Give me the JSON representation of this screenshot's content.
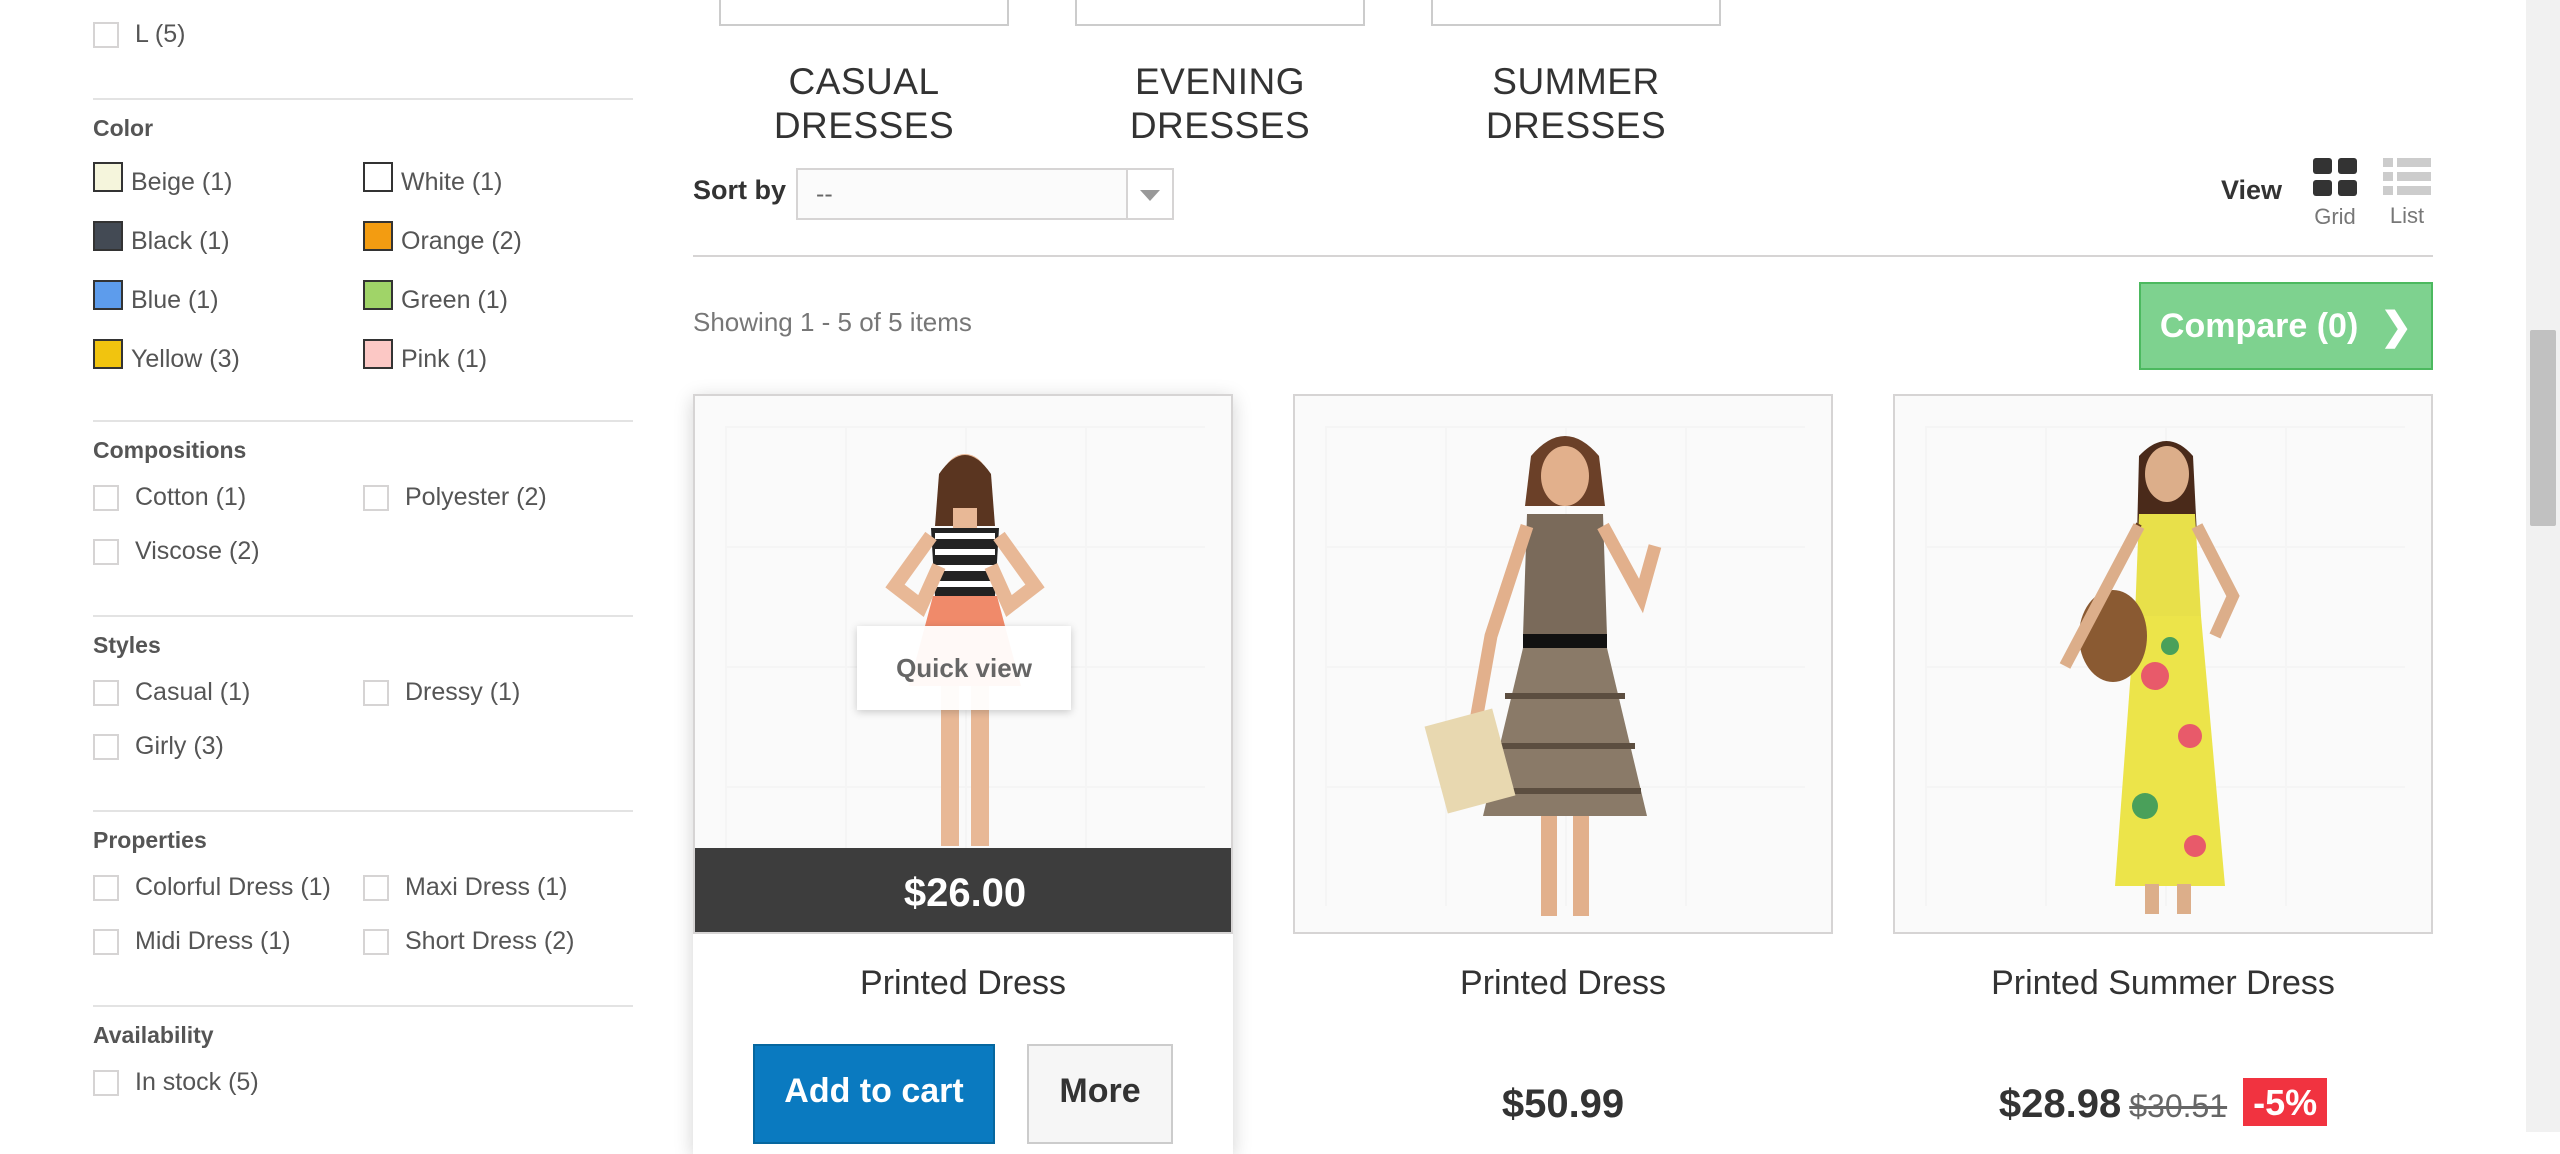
{
  "filters": {
    "size_partial": {
      "label": "L (5)"
    },
    "color": {
      "title": "Color",
      "items": [
        {
          "label": "Beige (1)",
          "color": "#f5f5dc"
        },
        {
          "label": "White (1)",
          "color": "#ffffff"
        },
        {
          "label": "Black (1)",
          "color": "#434a54"
        },
        {
          "label": "Orange (2)",
          "color": "#f39c11"
        },
        {
          "label": "Blue (1)",
          "color": "#5d9cec"
        },
        {
          "label": "Green (1)",
          "color": "#a0d468"
        },
        {
          "label": "Yellow (3)",
          "color": "#f1c40f"
        },
        {
          "label": "Pink (1)",
          "color": "#fcc8c5"
        }
      ]
    },
    "compositions": {
      "title": "Compositions",
      "items": [
        "Cotton (1)",
        "Polyester (2)",
        "Viscose (2)"
      ]
    },
    "styles": {
      "title": "Styles",
      "items": [
        "Casual (1)",
        "Dressy (1)",
        "Girly (3)"
      ]
    },
    "properties": {
      "title": "Properties",
      "items": [
        "Colorful Dress (1)",
        "Maxi Dress (1)",
        "Midi Dress (1)",
        "Short Dress (2)"
      ]
    },
    "availability": {
      "title": "Availability",
      "items": [
        "In stock (5)"
      ]
    }
  },
  "subcategories": [
    {
      "line1": "CASUAL",
      "line2": "DRESSES"
    },
    {
      "line1": "EVENING",
      "line2": "DRESSES"
    },
    {
      "line1": "SUMMER",
      "line2": "DRESSES"
    }
  ],
  "toolbar": {
    "sort_label": "Sort by",
    "sort_value": "--",
    "view_label": "View",
    "view_grid": "Grid",
    "view_list": "List"
  },
  "results": {
    "showing": "Showing 1 - 5 of 5 items",
    "compare_label": "Compare (0)"
  },
  "products": [
    {
      "name": "Printed Dress",
      "price": "$26.00",
      "quick_view": "Quick view",
      "add_to_cart": "Add to cart",
      "more": "More",
      "dress_color": "#f08a6a"
    },
    {
      "name": "Printed Dress",
      "price": "$50.99",
      "dress_color": "#7a6a5a"
    },
    {
      "name": "Printed Summer Dress",
      "price": "$28.98",
      "old_price": "$30.51",
      "discount": "-5%",
      "dress_color": "#e8e04a"
    }
  ]
}
